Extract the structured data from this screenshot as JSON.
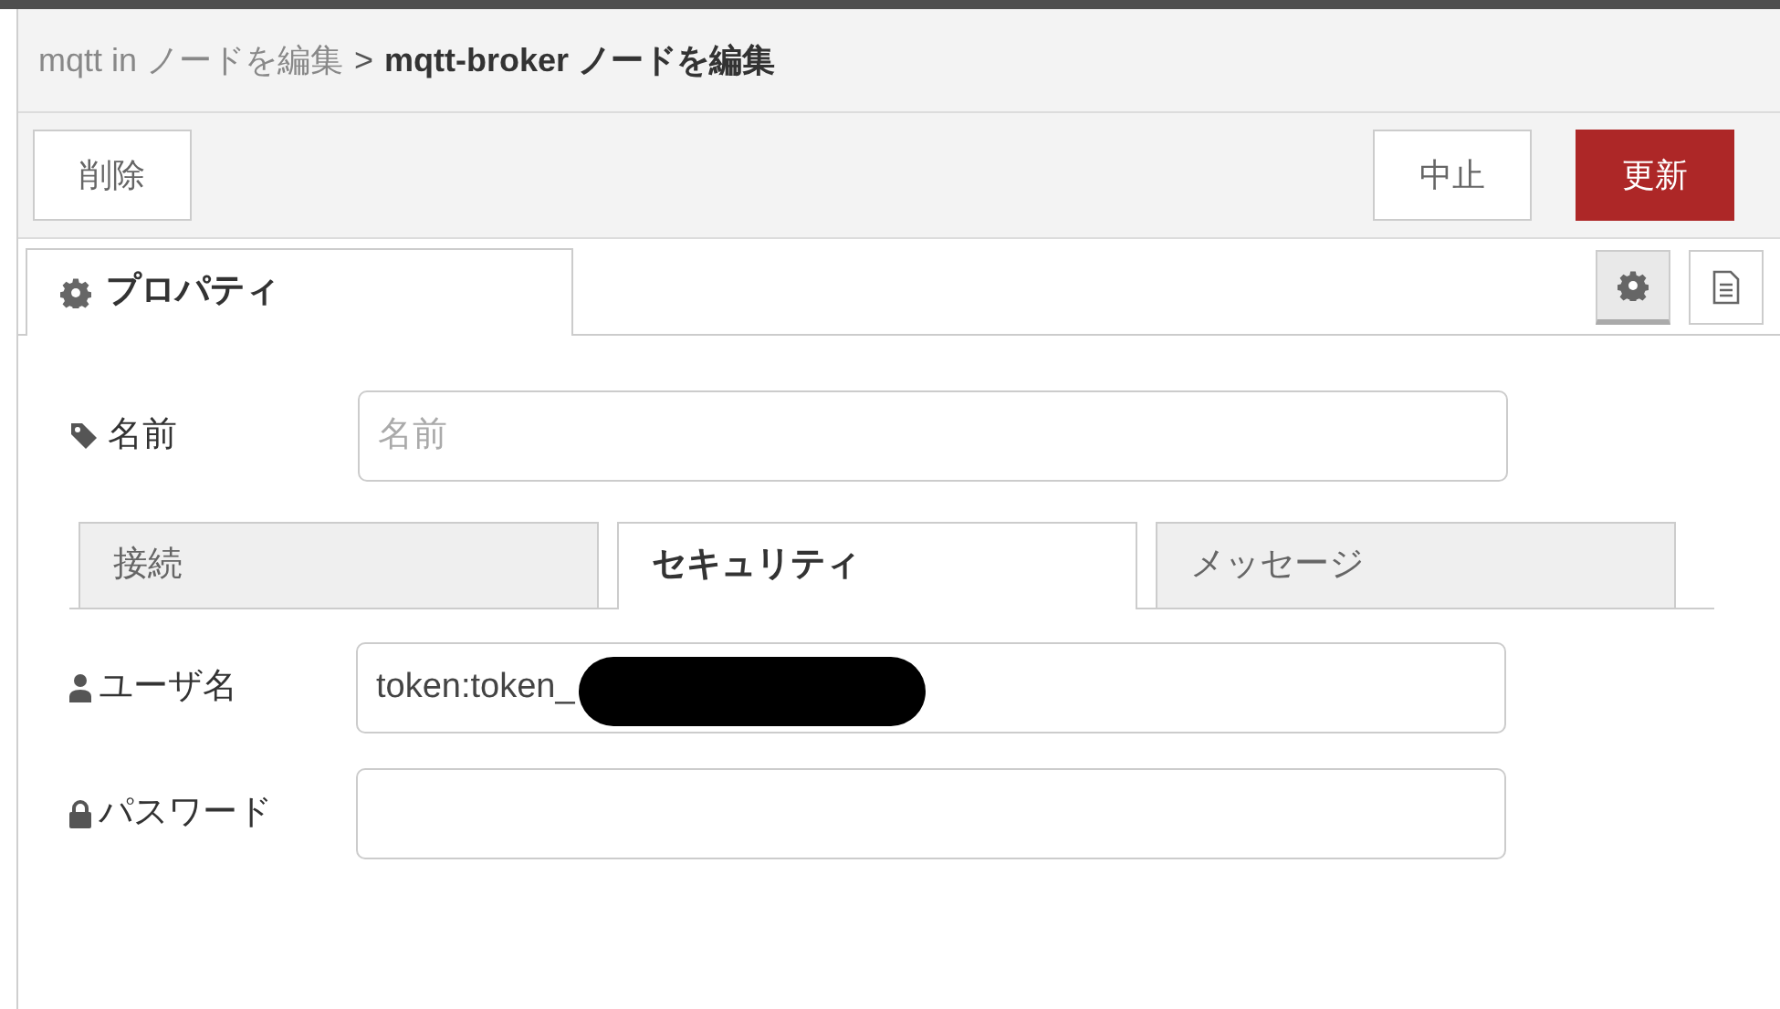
{
  "breadcrumb": [
    {
      "label": "mqtt in ノードを編集",
      "current": false
    },
    {
      "label": "mqtt-broker ノードを編集",
      "current": true
    }
  ],
  "breadcrumb_separator": ">",
  "buttons": {
    "delete": "削除",
    "cancel": "中止",
    "update": "更新"
  },
  "tabs": [
    {
      "label": "プロパティ",
      "selected": true
    }
  ],
  "side_tabs": [
    {
      "kind": "settings",
      "selected": true
    },
    {
      "kind": "description",
      "selected": false
    }
  ],
  "name_field": {
    "label": "名前",
    "placeholder": "名前"
  },
  "inner_tabs": [
    {
      "label": "接続",
      "selected": false
    },
    {
      "label": "セキュリティ",
      "selected": true
    },
    {
      "label": "メッセージ",
      "selected": false
    }
  ],
  "fields": [
    {
      "kind": "user",
      "label": "ユーザ名",
      "value": "token:token_",
      "redacted": true
    },
    {
      "kind": "lock",
      "label": "パスワード",
      "redacted": false
    }
  ]
}
